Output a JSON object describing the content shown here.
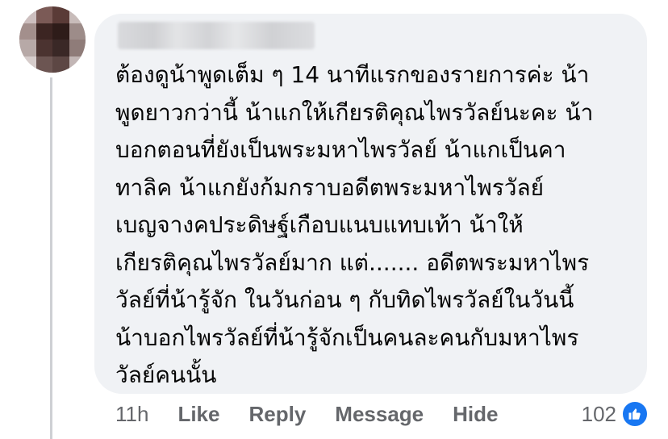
{
  "comment": {
    "lines": [
      "ต้องดูน้าพูดเต็ม ๆ 14 นาทีแรกของรายการค่ะ น้า",
      "พูดยาวกว่านี้ น้าแกให้เกียรติคุณไพรวัลย์นะคะ น้า",
      "บอกตอนที่ยังเป็นพระมหาไพรวัลย์ น้าแกเป็นคา",
      "ทาลิค น้าแกยังก้มกราบอดีตพระมหาไพรวัลย์",
      "เบญจางคประดิษฐ์เกือบแนบแทบเท้า น้าให้",
      "เกียรติคุณไพรวัลย์มาก แต่....... อดีตพระมหาไพร",
      "วัลย์ที่น้ารู้จัก ในวันก่อน ๆ กับทิดไพรวัลย์ในวันนี้",
      "น้าบอกไพรวัลย์ที่น้ารู้จักเป็นคนละคนกับมหาไพร",
      "วัลย์คนนั้น"
    ]
  },
  "actions": {
    "time": "11h",
    "like": "Like",
    "reply": "Reply",
    "message": "Message",
    "hide": "Hide"
  },
  "reactions": {
    "count": "102",
    "icon": "like-thumb-icon",
    "color": "#1877f2"
  }
}
